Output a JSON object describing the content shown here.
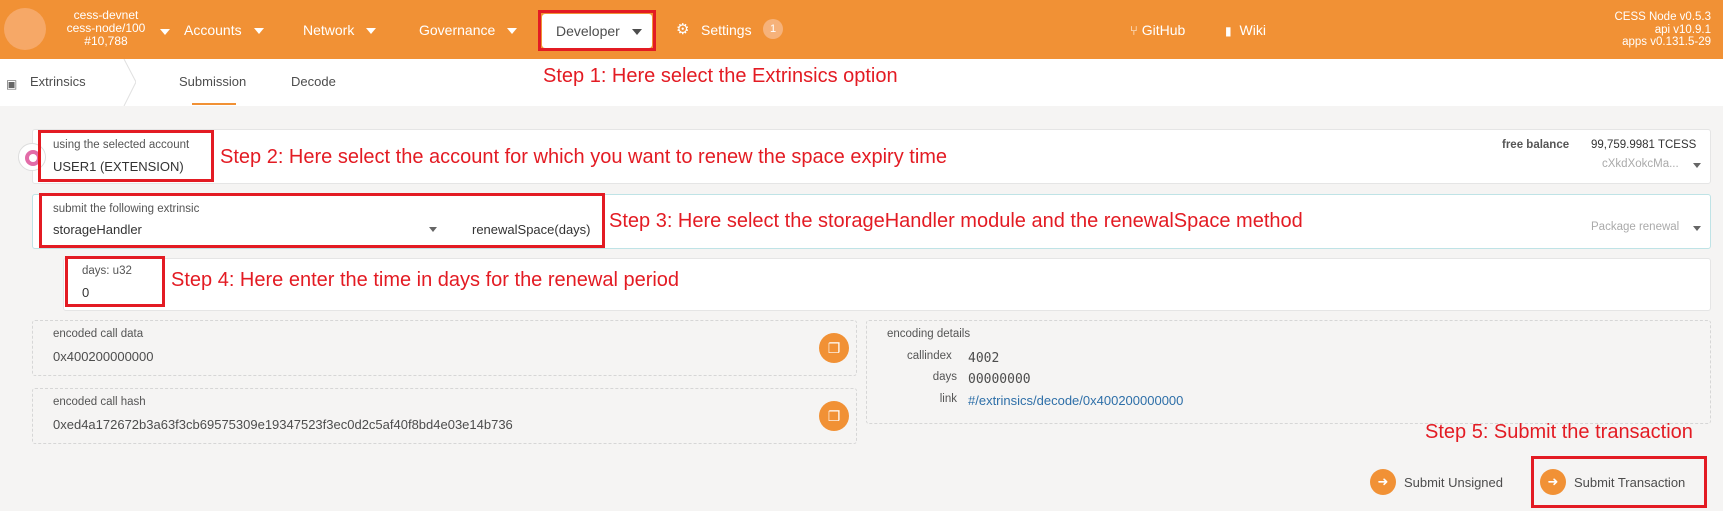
{
  "topbar": {
    "chain_name": "cess-devnet",
    "node": "cess-node/100",
    "block": "#10,788",
    "nav": [
      "Accounts",
      "Network",
      "Governance",
      "Developer",
      "Settings"
    ],
    "settings_badge": "1",
    "links": [
      "GitHub",
      "Wiki"
    ],
    "version": [
      "CESS Node v0.5.3",
      "api v10.9.1",
      "apps v0.131.5-29"
    ]
  },
  "subnav": {
    "section": "Extrinsics",
    "tabs": [
      "Submission",
      "Decode"
    ]
  },
  "form": {
    "account_label": "using the selected account",
    "account_value": "USER1 (EXTENSION)",
    "free_balance_label": "free balance",
    "free_balance_value": "99,759.9981 TCESS",
    "account_address": "cXkdXokcMa...",
    "extrinsic_label": "submit the following extrinsic",
    "module_value": "storageHandler",
    "method_value": "renewalSpace(days)",
    "method_doc": "Package renewal",
    "param_label": "days: u32",
    "param_value": "0",
    "call_data_label": "encoded call data",
    "call_data_value": "0x400200000000",
    "call_hash_label": "encoded call hash",
    "call_hash_value": "0xed4a172672b3a63f3cb69575309e19347523f3ec0d2c5af40f8bd4e03e14b736",
    "encoding_label": "encoding details",
    "callindex_label": "callindex",
    "callindex_value": "4002",
    "days_label": "days",
    "days_value": "00000000",
    "link_label": "link",
    "link_value": "#/extrinsics/decode/0x400200000000"
  },
  "buttons": {
    "submit_unsigned": "Submit Unsigned",
    "submit_transaction": "Submit Transaction"
  },
  "annotations": {
    "step1": "Step 1: Here select the Extrinsics option",
    "step2": "Step 2: Here select the account for which you want to renew the space expiry time",
    "step3": "Step 3: Here select the storageHandler module and the renewalSpace method",
    "step4": "Step 4: Here enter the time in days for the renewal period",
    "step5": "Step 5: Submit the transaction"
  },
  "colors": {
    "brand": "#f19135",
    "annotation": "#e31b23"
  }
}
